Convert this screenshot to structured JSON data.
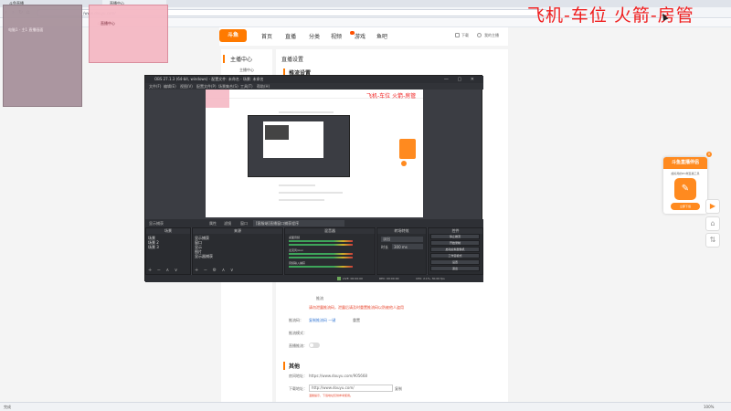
{
  "browser": {
    "tabs": [
      "斗鱼直播",
      "直播中心"
    ],
    "nav": {
      "back": "‹",
      "forward": "›",
      "refresh": "↻",
      "home": "⌂"
    },
    "url": "/www.douyu.com/",
    "url_hint": "creator",
    "bookmarks": [
      "斗鱼直播"
    ]
  },
  "overlay": {
    "pink_note": "直播中心",
    "dark_note": "电脑1 - 主1 直播画面",
    "big_red_text": "飞机-车位 火箭-房管"
  },
  "site": {
    "logo": "斗鱼",
    "nav": [
      "首页",
      "直播",
      "分类",
      "视频",
      "游戏",
      "鱼吧"
    ],
    "header_right": [
      "下载",
      "我的主播"
    ],
    "sidebar_title": "主播中心",
    "sidebar_sub": "主播中心",
    "content_title": "直播设置",
    "section1": "推流设置",
    "form": {
      "hint": "推流",
      "warning": "请勿泄露推流码，泄露后请及时重置推流码以防被他人盗用",
      "label_code": "推流码：",
      "code_value": "复制推流码 一键",
      "reset": "重置",
      "label_mode": "推流模式：",
      "label_push": "直播推流："
    },
    "section2": "其他",
    "other": {
      "label_room": "房间地址：",
      "room_value": "https://www.douyu.com/905668",
      "label_download": "下载地址：",
      "download_value": "http://www.douyu.com/",
      "copy": "复制",
      "download_warning": "温馨提示，下载地址仅供参考使用。"
    }
  },
  "promo": {
    "title": "斗鱼直播伴侣",
    "subtitle": "超好用的PC端直播工具",
    "button": "立即下载",
    "close": "×"
  },
  "float": [
    "▶",
    "⌂",
    "⇅"
  ],
  "obs": {
    "title": "OBS 27.1.3 (64-bit, windows) - 配置文件: 未命名 - 场景: 未命名",
    "menu": [
      "文件(F)",
      "编辑(E)",
      "视图(V)",
      "配置文件(P)",
      "场景集合(S)",
      "工具(T)",
      "帮助(H)"
    ],
    "preview_red": "飞机-车位 火箭-房管",
    "bar": {
      "source_label": "显示捕获",
      "props": "属性",
      "filters": "滤镜",
      "window_label": "窗口",
      "window_value": "[客服端]直播窗口捕获程序"
    },
    "panels": {
      "scenes": {
        "title": "场景",
        "items": [
          "场景",
          "场景 2",
          "场景 3"
        ]
      },
      "sources": {
        "title": "来源",
        "items": [
          "显示捕获",
          "窗口",
          "显示",
          "图片",
          "显示器捕获"
        ]
      },
      "mixer": {
        "title": "混音器",
        "items": [
          "桌面音频",
          "麦克风/Aux",
          "音频输入捕获"
        ]
      },
      "transitions": {
        "title": "转场特效",
        "type": "淡出",
        "duration_label": "时长",
        "duration_value": "300 ms"
      },
      "controls": {
        "title": "控件",
        "buttons": [
          "停止推流",
          "开始录制",
          "启动虚拟摄像机",
          "工作室模式",
          "设置",
          "退出"
        ]
      }
    },
    "status": [
      "LIVE: 00:00:00",
      "REC: 00:00:00",
      "CPU: 2.1%, 30.00 fps"
    ]
  },
  "statusbar": {
    "left": "完成",
    "right": "100%"
  }
}
